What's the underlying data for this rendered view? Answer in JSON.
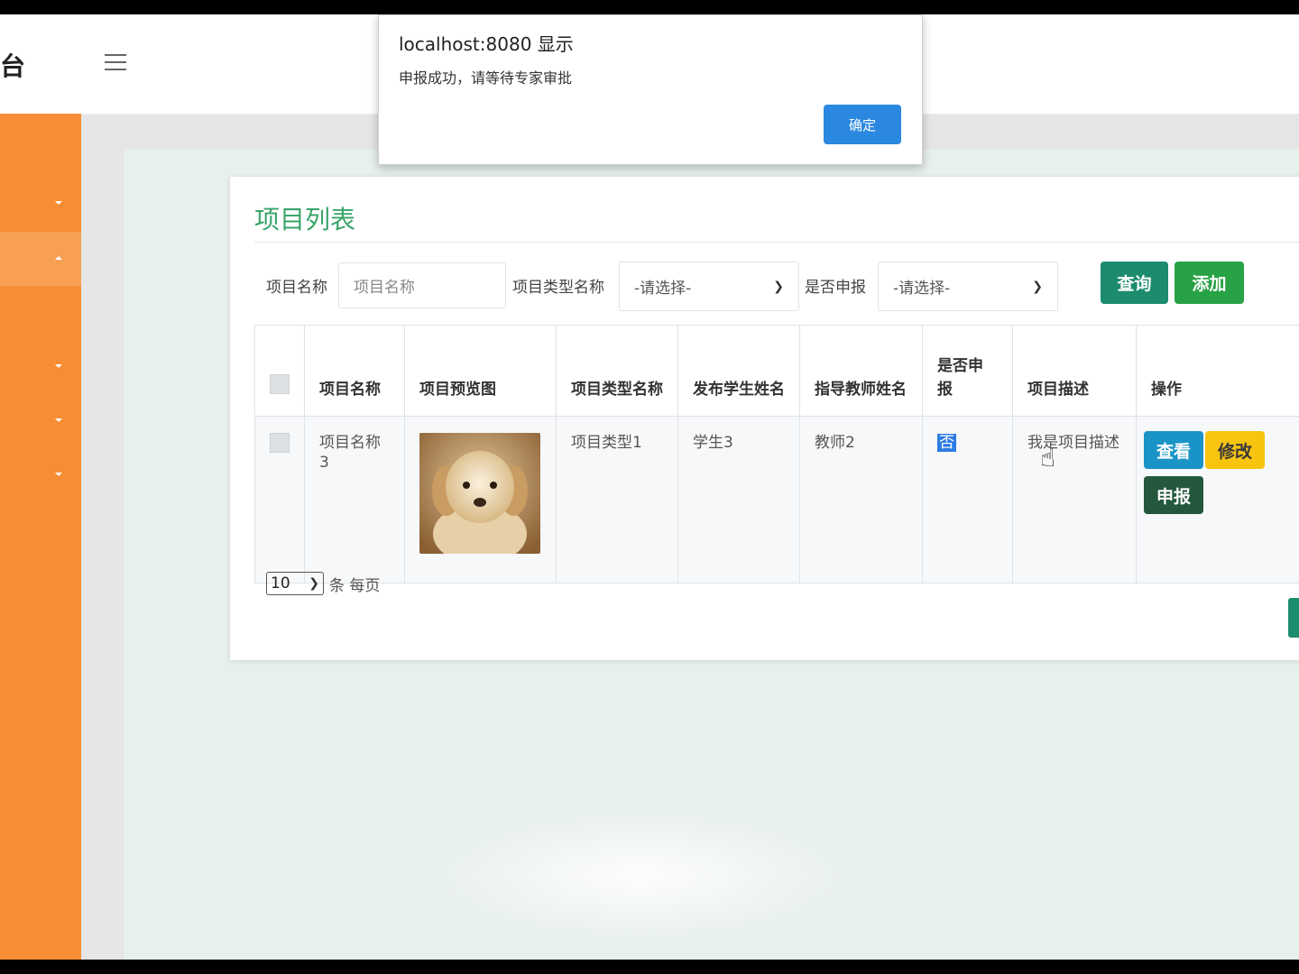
{
  "header": {
    "brand": "台"
  },
  "dialog": {
    "title": "localhost:8080 显示",
    "message": "申报成功，请等待专家审批",
    "ok_label": "确定"
  },
  "page": {
    "title": "项目列表"
  },
  "search": {
    "name_label": "项目名称",
    "name_placeholder": "项目名称",
    "type_label": "项目类型名称",
    "type_value": "-请选择-",
    "submitted_label": "是否申报",
    "submitted_value": "-请选择-",
    "query_label": "查询",
    "add_label": "添加"
  },
  "table": {
    "columns": [
      "项目名称",
      "项目预览图",
      "项目类型名称",
      "发布学生姓名",
      "指导教师姓名",
      "是否申报",
      "项目描述",
      "操作"
    ],
    "rows": [
      {
        "name": "项目名称3",
        "type": "项目类型1",
        "student": "学生3",
        "teacher": "教师2",
        "submitted": "否",
        "description": "我是项目描述",
        "actions": {
          "view": "查看",
          "edit": "修改",
          "submit": "申报"
        }
      }
    ]
  },
  "pager": {
    "page_size": "10",
    "suffix": "条 每页"
  },
  "colors": {
    "sidebar": "#f78d34",
    "title": "#3aa46a",
    "query": "#1d8c6e",
    "add": "#27a245"
  }
}
